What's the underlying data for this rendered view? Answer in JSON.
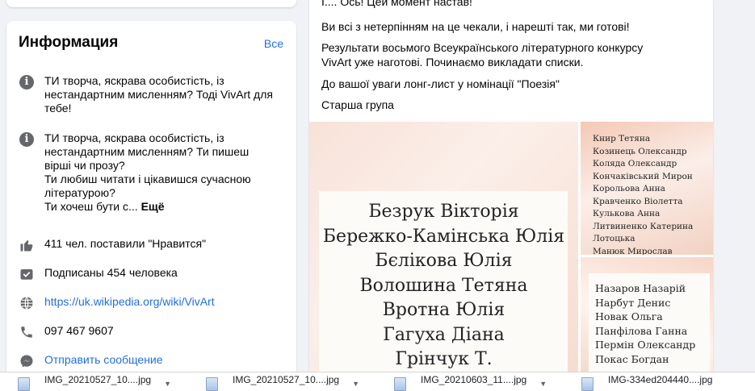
{
  "info": {
    "title": "Информация",
    "all_link": "Все",
    "about_1": "ТИ творча, яскрава особистість, із нестандартним мисленням? Тоді VivArt для тебе!",
    "about_2_lines": [
      "ТИ творча, яскрава особистість, із",
      "нестандартним мисленням? Ти пишеш",
      "вірші чи прозу?",
      "Ти любиш читати і цікавишся сучасною",
      "літературою?"
    ],
    "about_2_tail": "Ти хочеш бути с...",
    "more": "Ещё",
    "likes": "411 чел. поставили \"Нравится\"",
    "followers": "Подписаны 454 человека",
    "website": "https://uk.wikipedia.org/wiki/VivArt",
    "phone": "097 467 9607",
    "message": "Отправить сообщение",
    "icons": [
      "info-icon",
      "info-icon",
      "thumbs-up-icon",
      "check-icon",
      "globe-icon",
      "phone-icon",
      "messenger-icon"
    ]
  },
  "post": {
    "lines": [
      "І.... Ось! Цей момент настав!",
      "Ви всі з нетерпінням на це чекали, і нарешті так, ми готові!",
      "Результати восьмого Всеукраїнського літературного конкурсу",
      "VivArt уже наготові. Починаємо викладати списки.",
      "До вашої уваги лонг-лист у номінації \"Поезія\"",
      "Старша група"
    ],
    "image_main_names": [
      "Безрук Вікторія",
      "Бережко-Камінська Юлія",
      "Бєлікова Юлія",
      "Волошина Тетяна",
      "Вротна Юлія",
      "Гагуха Діана",
      "Грінчук Т."
    ],
    "image_side1_names": [
      "Книр Тетяна",
      "Козинець Олександр",
      "Коляда Олександр",
      "Кончаківський Мирон",
      "Корольова Анна",
      "Кравченко Віолетта",
      "Кулькова  Анна",
      "Литвиненко Катерина",
      "Лотоцька",
      "Манюк Мирослав"
    ],
    "image_side2_names": [
      "Назаров  Назарій",
      "Нарбут Денис",
      "Новак Ольга",
      "Панфілова Ганна",
      "Пермін Олександр",
      "Покас Богдан"
    ]
  },
  "downloads": [
    {
      "name": "IMG_20210527_10....jpg"
    },
    {
      "name": "IMG_20210527_10....jpg"
    },
    {
      "name": "IMG_20210603_11....jpg"
    },
    {
      "name": "IMG-334ed204440....jpg"
    }
  ],
  "colors": {
    "link": "#216fdb",
    "icon": "#65676b",
    "page_bg": "#f0f2f5"
  }
}
